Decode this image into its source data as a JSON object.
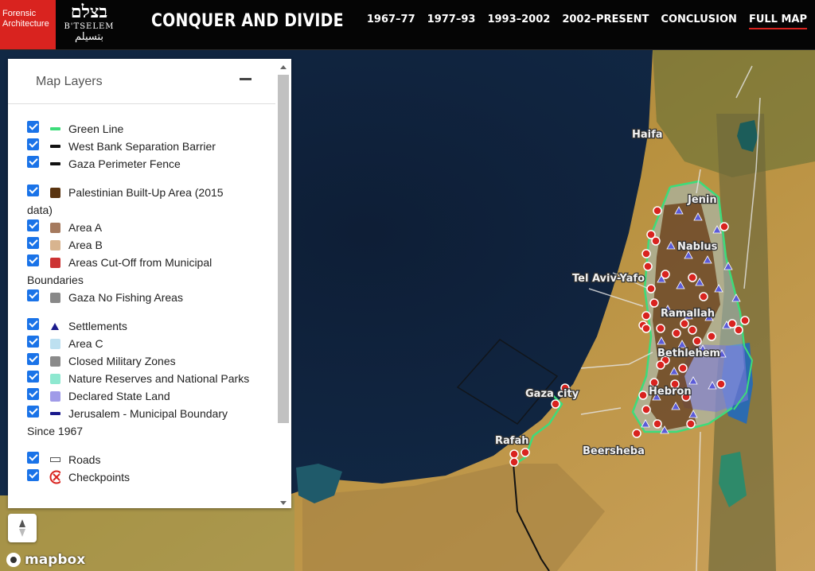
{
  "header": {
    "fa_logo": "Forensic Architecture",
    "btselem_hebrew": "בצלם",
    "btselem_latin": "B'TSELEM",
    "btselem_arabic": "بتسيلم",
    "title": "CONQUER AND DIVIDE",
    "nav": [
      {
        "label": "1967–77"
      },
      {
        "label": "1977–93"
      },
      {
        "label": "1993–2002"
      },
      {
        "label": "2002–PRESENT"
      },
      {
        "label": "CONCLUSION"
      },
      {
        "label": "FULL MAP",
        "active": true
      }
    ]
  },
  "panel": {
    "title": "Map Layers",
    "groups": [
      [
        {
          "label": "Green Line",
          "swatch": "line",
          "color": "#3ddc7a"
        },
        {
          "label": "West Bank Separation Barrier",
          "swatch": "line",
          "color": "#111111"
        },
        {
          "label": "Gaza Perimeter Fence",
          "swatch": "line",
          "color": "#111111"
        }
      ],
      [
        {
          "label": "Palestinian Built-Up Area (2015",
          "label_cont": "data)",
          "swatch": "box",
          "color": "#5a3410"
        },
        {
          "label": "Area A",
          "swatch": "box",
          "color": "#a57a5e"
        },
        {
          "label": "Area B",
          "swatch": "box",
          "color": "#d8b48f"
        },
        {
          "label": "Areas Cut-Off from Municipal",
          "label_cont": "Boundaries",
          "swatch": "box",
          "color": "#cc3333"
        },
        {
          "label": "Gaza No Fishing Areas",
          "swatch": "box",
          "color": "#888888"
        }
      ],
      [
        {
          "label": "Settlements",
          "swatch": "triangle",
          "color": "#1a1a8c"
        },
        {
          "label": "Area C",
          "swatch": "box",
          "color": "#bde0f0"
        },
        {
          "label": "Closed Military Zones",
          "swatch": "box",
          "color": "#8a8a8a"
        },
        {
          "label": "Nature Reserves and National Parks",
          "swatch": "box",
          "color": "#8ee8d0"
        },
        {
          "label": "Declared State Land",
          "swatch": "box",
          "color": "#a09be8"
        },
        {
          "label": "Jerusalem - Municipal Boundary",
          "label_cont": "Since 1967",
          "swatch": "line",
          "color": "#1a1a8c"
        }
      ],
      [
        {
          "label": "Roads",
          "swatch": "road",
          "color": "#ffffff"
        },
        {
          "label": "Checkpoints",
          "swatch": "checkpoint",
          "color": "#d9231f"
        }
      ]
    ]
  },
  "map": {
    "places": [
      {
        "name": "Haifa"
      },
      {
        "name": "Jenin"
      },
      {
        "name": "Nablus"
      },
      {
        "name": "Tel Aviv-Yafo"
      },
      {
        "name": "Ramallah"
      },
      {
        "name": "Bethlehem"
      },
      {
        "name": "Hebron"
      },
      {
        "name": "Gaza city"
      },
      {
        "name": "Rafah"
      },
      {
        "name": "Beersheba"
      }
    ],
    "attribution": "mapbox"
  }
}
